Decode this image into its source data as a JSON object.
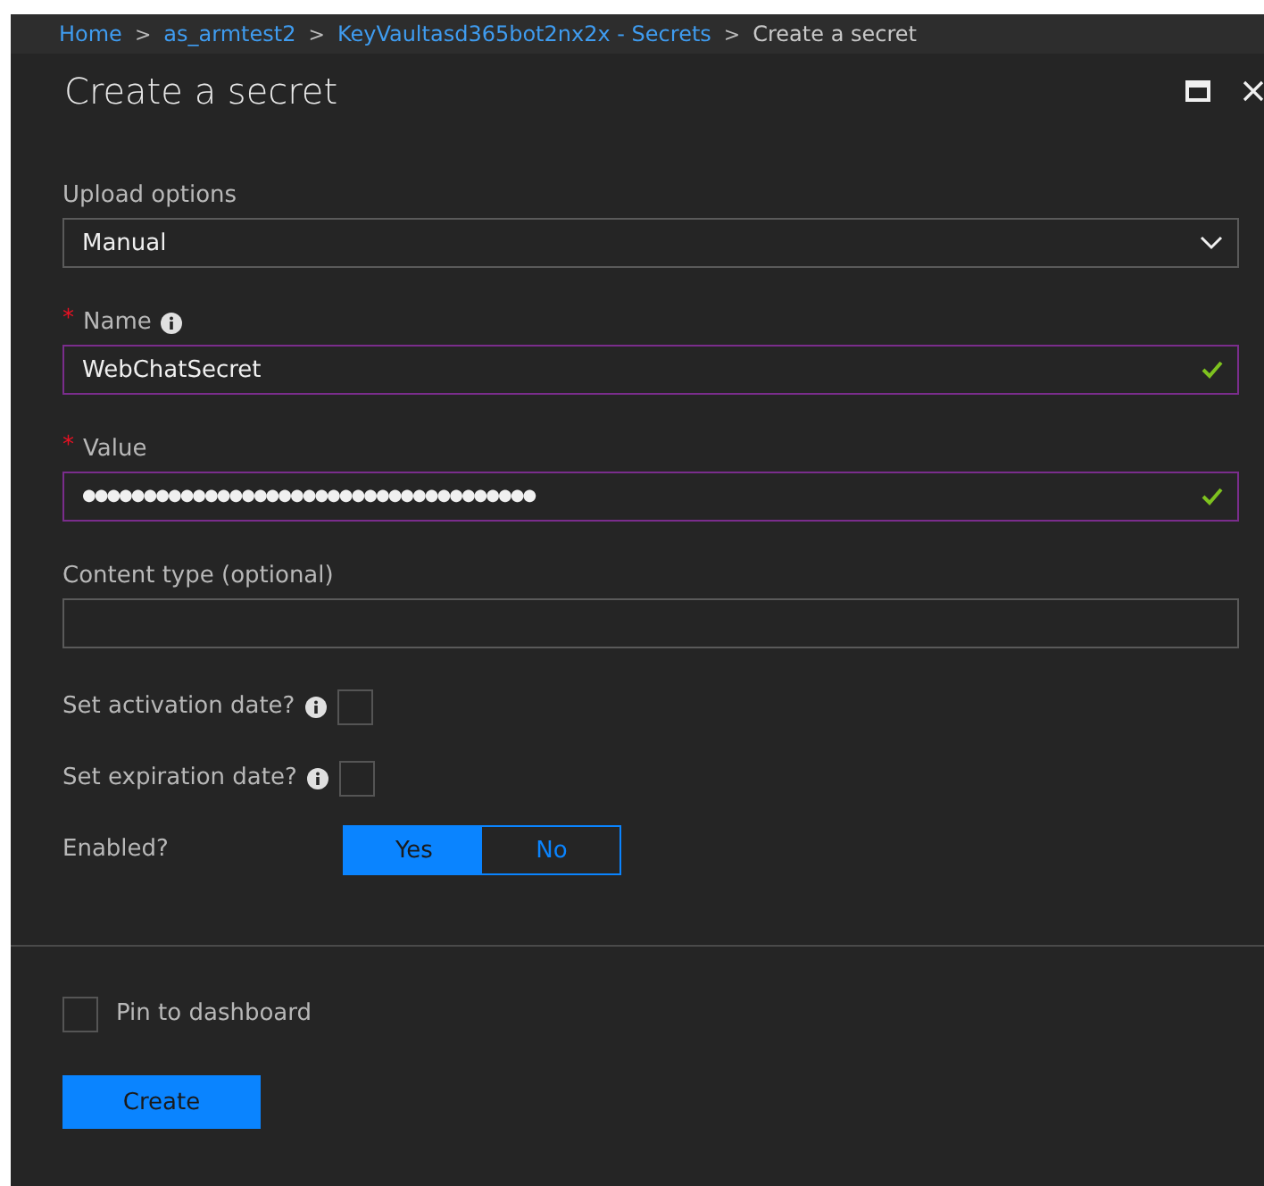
{
  "breadcrumb": [
    {
      "label": "Home",
      "current": false
    },
    {
      "label": "as_armtest2",
      "current": false
    },
    {
      "label": "KeyVaultasd365bot2nx2x - Secrets",
      "current": false
    },
    {
      "label": "Create a secret",
      "current": true
    }
  ],
  "breadcrumb_separator": ">",
  "title": "Create a secret",
  "upload": {
    "label": "Upload options",
    "value": "Manual"
  },
  "fields": [
    {
      "label": "Name",
      "required": true,
      "info": true,
      "value": "WebChatSecret",
      "valid": true
    },
    {
      "label": "Value",
      "required": true,
      "info": false,
      "value": "●●●●●●●●●●●●●●●●●●●●●●●●●●●●●●●●●●●●●",
      "valid": true
    },
    {
      "label": "Content type (optional)",
      "required": false,
      "info": false,
      "valid": false
    }
  ],
  "required_mark": "*",
  "date_options": [
    {
      "label": "Set activation date?",
      "checked": false
    },
    {
      "label": "Set expiration date?",
      "checked": false
    }
  ],
  "enabled": {
    "label": "Enabled?",
    "options": [
      {
        "label": "Yes",
        "selected": true
      },
      {
        "label": "No",
        "selected": false
      }
    ]
  },
  "pin": {
    "label": "Pin to dashboard",
    "checked": false
  },
  "create_button": "Create"
}
